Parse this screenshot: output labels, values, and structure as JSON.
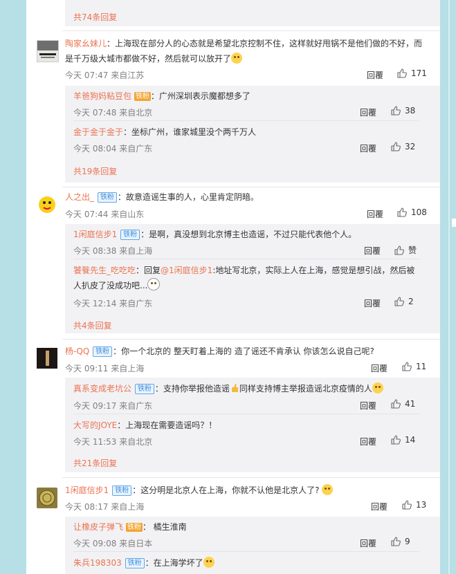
{
  "top": {
    "more_text": "共74条回复"
  },
  "labels": {
    "reply": "回覆",
    "badge_iron": "铁粉",
    "badge_gold": "铁粉"
  },
  "comments": [
    {
      "user": "陶家幺妹儿",
      "text": "：上海现在部分人的心态就是希望北京控制不住，这样就好甩锅不是他们做的不好，而是千万级大城市都做不好，然后就可以放开了",
      "meta": "今天 07:47 来自江苏",
      "likes": "171",
      "subs": [
        {
          "user": "羊爸狗妈粘豆包",
          "text": "：广州深圳表示魔都想多了",
          "meta": "今天 07:48 来自北京",
          "likes": "38"
        },
        {
          "user": "金于金于金于",
          "text": "：坐标广州，谁家城里没个两千万人",
          "meta": "今天 08:04 来自广东",
          "likes": "32"
        }
      ],
      "more": "共19条回复"
    },
    {
      "user": "人之出_",
      "text": "：故意造谣生事的人，心里肯定阴暗。",
      "meta": "今天 07:44 来自山东",
      "likes": "108",
      "subs": [
        {
          "user": "1闲庭信步1",
          "text": "：是啊，真没想到北京博主也造谣，不过只能代表他个人。",
          "meta": "今天 08:38 来自上海",
          "likes": "赞"
        },
        {
          "user": "饕餮先生_吃吃吃",
          "text_prefix": "：回复",
          "mention": "@1闲庭信步1",
          "text": ":地址写北京，实际上人在上海，感觉是想引战，然后被人扒皮了没成功吧...",
          "meta": "今天 12:14 来自广东",
          "likes": "2"
        }
      ],
      "more": "共4条回复"
    },
    {
      "user": "杨-QQ",
      "text": "：你一个北京的 整天盯着上海的 造了谣还不肯承认 你该怎么说自己呢?",
      "meta": "今天 09:11 来自上海",
      "likes": "11",
      "subs": [
        {
          "user": "真系变成老坑公",
          "text": "：支持你举报他造谣",
          "text2": "同样支持博主举报造谣北京疫情的人",
          "meta": "今天 09:17 来自广东",
          "likes": "41"
        },
        {
          "user": "大写的JOYE",
          "text": "：上海现在需要造谣吗？！",
          "meta": "今天 11:53 来自北京",
          "likes": "14"
        }
      ],
      "more": "共21条回复"
    },
    {
      "user": "1闲庭信步1",
      "text": "：这分明是北京人在上海，你就不认他是北京人了?",
      "meta": "今天 08:17 来自上海",
      "likes": "13",
      "subs": [
        {
          "user": "让橡皮子弹飞",
          "text": "：   橘生淮南",
          "meta": "今天 09:08 来自日本",
          "likes": "9"
        },
        {
          "user": "朱兵198303",
          "text": "：在上海学坏了",
          "meta": "",
          "likes": ""
        }
      ]
    }
  ],
  "colors": {
    "link": "#eb7350",
    "meta": "#808080",
    "sub_bg": "#f2f2f5",
    "badge": "#3f8fdc",
    "page_bg": "#b6dfe6"
  }
}
